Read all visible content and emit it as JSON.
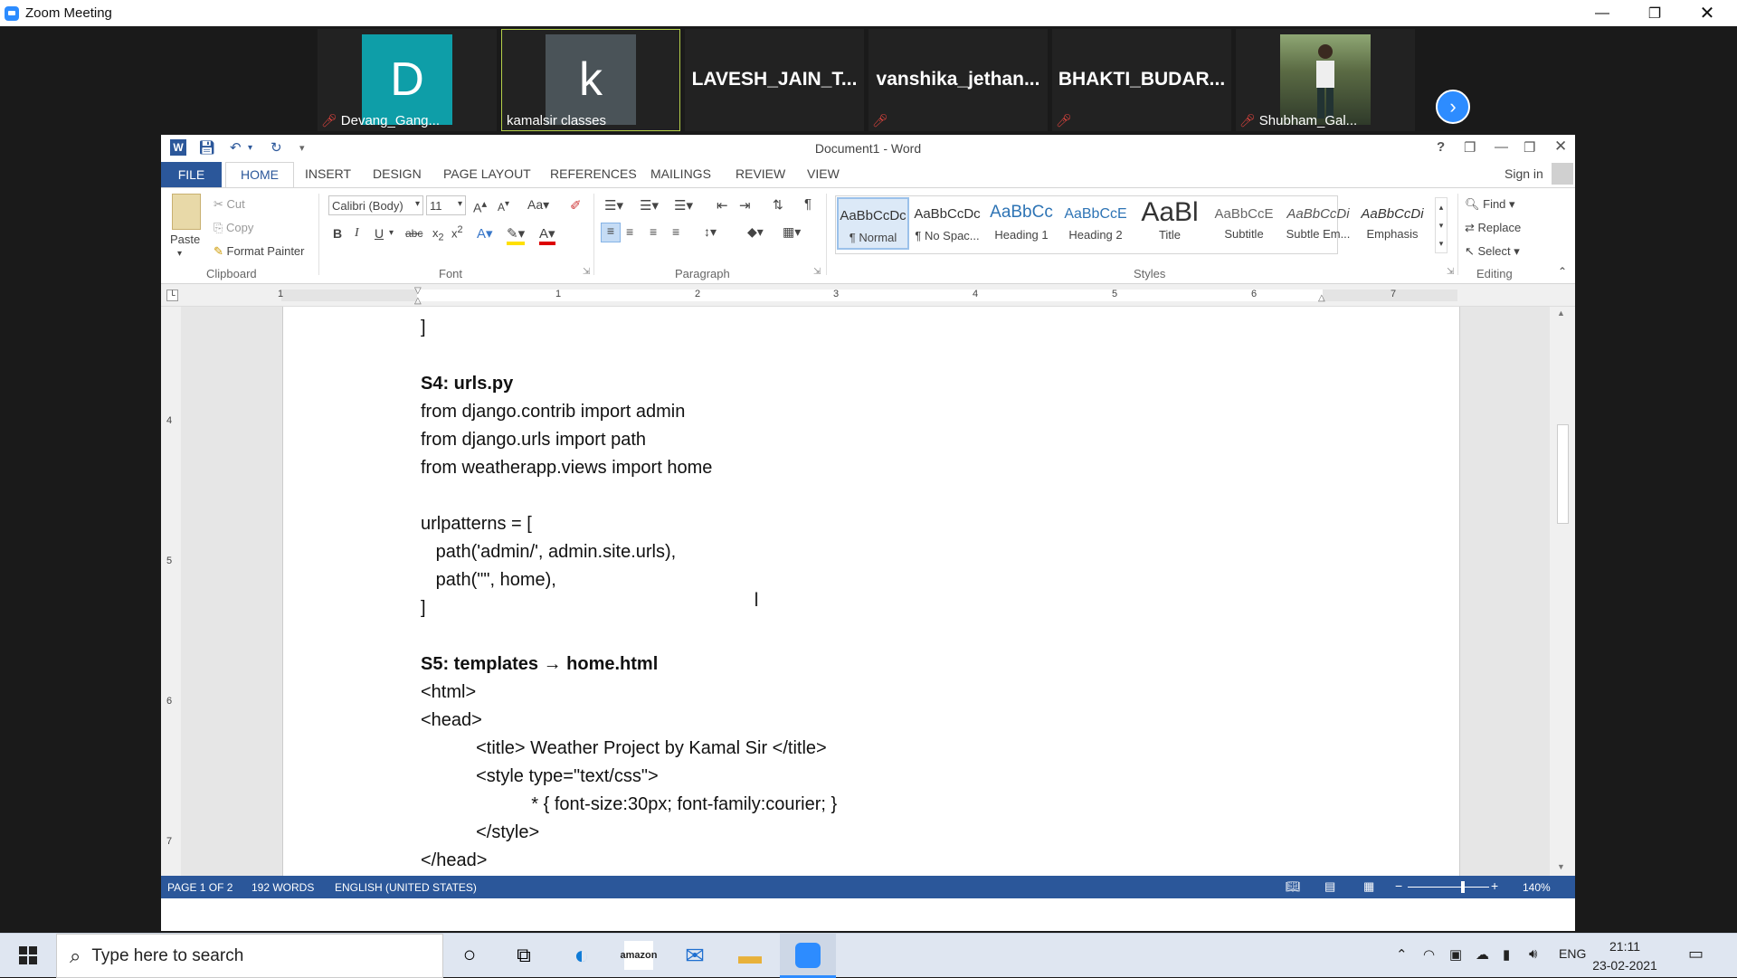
{
  "zoom": {
    "title": "Zoom Meeting",
    "participants": [
      {
        "initial": "D",
        "name": "Devang_Gang...",
        "color": "#0e9ea8",
        "muted": true
      },
      {
        "initial": "k",
        "name": "kamalsir classes",
        "color": "#4a5358",
        "muted": false
      },
      {
        "big": "LAVESH_JAIN_T..."
      },
      {
        "big": "vanshika_jethan...",
        "muted": true
      },
      {
        "big": "BHAKTI_BUDAR...",
        "muted": true
      },
      {
        "name": "Shubham_Gal...",
        "muted": true,
        "photo": true
      }
    ],
    "next_icon": "chevron-right-icon"
  },
  "word": {
    "title": "Document1 - Word",
    "help": "?",
    "sign_in": "Sign in",
    "tabs": [
      "FILE",
      "HOME",
      "INSERT",
      "DESIGN",
      "PAGE LAYOUT",
      "REFERENCES",
      "MAILINGS",
      "REVIEW",
      "VIEW"
    ],
    "ribbon": {
      "paste": "Paste",
      "cut": "Cut",
      "copy": "Copy",
      "format_painter": "Format Painter",
      "font_name": "Calibri (Body)",
      "font_size": "11",
      "change_case": "Aa",
      "styles": [
        {
          "preview": "AaBbCcDc",
          "label": "¶ Normal"
        },
        {
          "preview": "AaBbCcDc",
          "label": "¶ No Spac..."
        },
        {
          "preview": "AaBbCc",
          "label": "Heading 1"
        },
        {
          "preview": "AaBbCcE",
          "label": "Heading 2"
        },
        {
          "preview": "AaBl",
          "label": "Title"
        },
        {
          "preview": "AaBbCcE",
          "label": "Subtitle"
        },
        {
          "preview": "AaBbCcDi",
          "label": "Subtle Em..."
        },
        {
          "preview": "AaBbCcDi",
          "label": "Emphasis"
        }
      ],
      "find": "Find",
      "replace": "Replace",
      "select": "Select",
      "groups": {
        "clipboard": "Clipboard",
        "font": "Font",
        "paragraph": "Paragraph",
        "styles": "Styles",
        "editing": "Editing"
      }
    },
    "ruler_numbers": [
      "1",
      "1",
      "2",
      "3",
      "4",
      "5",
      "6",
      "7"
    ],
    "vruler_numbers": [
      "4",
      "5",
      "6",
      "7"
    ],
    "document_lines": [
      {
        "text": "]",
        "bold": false
      },
      {
        "text": "",
        "bold": false
      },
      {
        "text": "S4: urls.py",
        "bold": true
      },
      {
        "text": "from django.contrib import admin",
        "bold": false
      },
      {
        "text": "from django.urls import path",
        "bold": false
      },
      {
        "text": "from weatherapp.views import home",
        "bold": false
      },
      {
        "text": "",
        "bold": false
      },
      {
        "text": "urlpatterns = [",
        "bold": false
      },
      {
        "text": "   path('admin/', admin.site.urls),",
        "bold": false
      },
      {
        "text": "   path(\"\", home),",
        "bold": false
      },
      {
        "text": "]",
        "bold": false
      },
      {
        "text": "",
        "bold": false
      },
      {
        "text": "S5: templates → home.html",
        "bold": true
      },
      {
        "text": "<html>",
        "bold": false
      },
      {
        "text": "<head>",
        "bold": false
      },
      {
        "text": "           <title> Weather Project by Kamal Sir </title>",
        "bold": false
      },
      {
        "text": "           <style type=\"text/css\">",
        "bold": false
      },
      {
        "text": "                      * { font-size:30px; font-family:courier; }",
        "bold": false
      },
      {
        "text": "           </style>",
        "bold": false
      },
      {
        "text": "</head>",
        "bold": false
      }
    ],
    "status": {
      "page": "PAGE 1 OF 2",
      "words": "192 WORDS",
      "language": "ENGLISH (UNITED STATES)",
      "zoom": "140%"
    }
  },
  "taskbar": {
    "search_placeholder": "Type here to search",
    "tray_language": "ENG",
    "time": "21:11",
    "date": "23-02-2021"
  }
}
